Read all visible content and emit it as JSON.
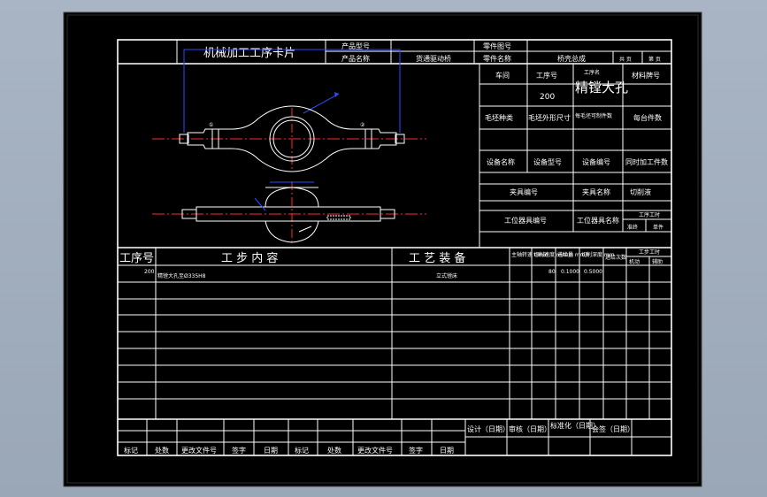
{
  "card": {
    "title": "机械加工工序卡片",
    "product_model_label": "产品型号",
    "product_name_label": "产品名称",
    "product_name_value": "货通驱动桥",
    "part_no_label": "零件图号",
    "part_name_label": "零件名称",
    "part_name_value": "桥壳总成",
    "sheet_total": "共  页",
    "sheet_no": "第  页"
  },
  "info": {
    "workshop": "车间",
    "op_no": "工序号",
    "op_name": "工序名",
    "material": "材料牌号",
    "op_no_value": "200",
    "op_name_value": "精镗大孔",
    "blank_type": "毛坯种类",
    "blank_size": "毛坯外形尺寸",
    "per_blank": "每毛坯可制件数",
    "per_unit": "每台件数",
    "equip_name": "设备名称",
    "equip_model": "设备型号",
    "equip_no": "设备编号",
    "simul_parts": "同时加工件数",
    "fixture_no": "夹具编号",
    "fixture_name": "夹具名称",
    "coolant": "切削液",
    "station_tool_no": "工位器具编号",
    "station_tool_name": "工位器具名称",
    "op_hours": "工序工时",
    "standard": "准终",
    "unit": "单件"
  },
  "steps": {
    "h_no": "工序号",
    "h_content": "工 步 内 容",
    "h_equip": "工 艺 装 备",
    "h_speed": "主轴转速 r/min",
    "h_cut_speed": "切削速度 m/min",
    "h_feed": "进给量 mm/r",
    "h_depth": "切削深度 mm",
    "h_passes": "进给次数",
    "h_time": "工步工时",
    "h_time_maneuver": "机动",
    "h_time_aux": "辅助",
    "rows": [
      {
        "no": "200",
        "content": "精镗大孔至Ø335H8",
        "equip": "立式镗床",
        "speed": "",
        "cut_speed": "80",
        "feed": "0.1000",
        "depth": "0.5000"
      }
    ]
  },
  "footer": {
    "design": "设计（日期）",
    "review": "审核（日期）",
    "standard": "标准化（日期）",
    "sign": "会签（日期）",
    "mark": "标记",
    "count": "处数",
    "change_doc": "更改文件号",
    "signature": "签字",
    "date": "日期"
  },
  "colors": {
    "background": "#000000",
    "lines": "#ffffff",
    "centerline": "#ff2a2a",
    "dimension": "#2b4dff"
  }
}
